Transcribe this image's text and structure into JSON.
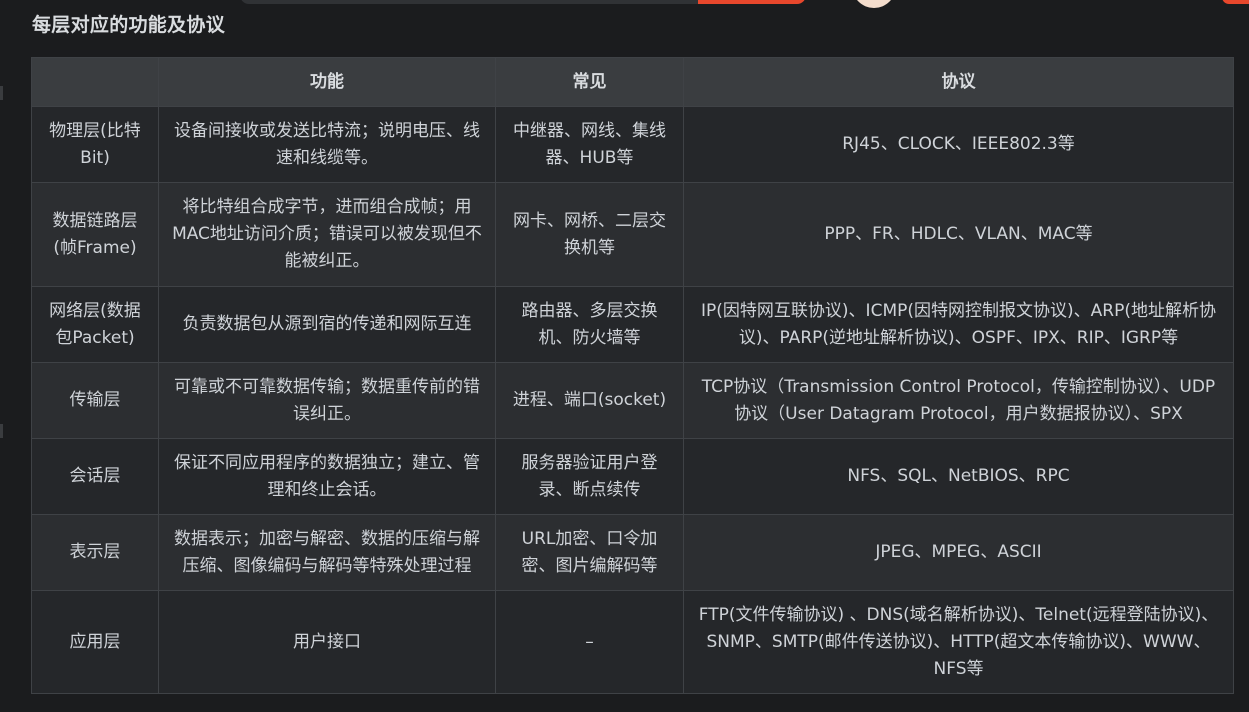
{
  "section_title": "每层对应的功能及协议",
  "table": {
    "headers": [
      "",
      "功能",
      "常见",
      "协议"
    ],
    "rows": [
      {
        "layer": "物理层(比特Bit)",
        "function": "设备间接收或发送比特流；说明电压、线速和线缆等。",
        "common": "中继器、网线、集线器、HUB等",
        "protocol": "RJ45、CLOCK、IEEE802.3等"
      },
      {
        "layer": "数据链路层(帧Frame)",
        "function": "将比特组合成字节，进而组合成帧；用MAC地址访问介质；错误可以被发现但不能被纠正。",
        "common": "网卡、网桥、二层交换机等",
        "protocol": "PPP、FR、HDLC、VLAN、MAC等"
      },
      {
        "layer": "网络层(数据包Packet)",
        "function": "负责数据包从源到宿的传递和网际互连",
        "common": "路由器、多层交换机、防火墙等",
        "protocol": "IP(因特网互联协议)、ICMP(因特网控制报文协议)、ARP(地址解析协议)、PARP(逆地址解析协议)、OSPF、IPX、RIP、IGRP等"
      },
      {
        "layer": "传输层",
        "function": "可靠或不可靠数据传输；数据重传前的错误纠正。",
        "common": "进程、端口(socket)",
        "protocol": "TCP协议（Transmission Control Protocol，传输控制协议）、UDP协议（User Datagram Protocol，用户数据报协议）、SPX"
      },
      {
        "layer": "会话层",
        "function": "保证不同应用程序的数据独立；建立、管理和终止会话。",
        "common": "服务器验证用户登录、断点续传",
        "protocol": "NFS、SQL、NetBIOS、RPC"
      },
      {
        "layer": "表示层",
        "function": "数据表示；加密与解密、数据的压缩与解压缩、图像编码与解码等特殊处理过程",
        "common": "URL加密、口令加密、图片编解码等",
        "protocol": "JPEG、MPEG、ASCII"
      },
      {
        "layer": "应用层",
        "function": "用户接口",
        "common": "–",
        "protocol": "FTP(文件传输协议) 、DNS(域名解析协议)、Telnet(远程登陆协议)、SNMP、SMTP(邮件传送协议)、HTTP(超文本传输协议)、WWW、NFS等"
      }
    ]
  }
}
